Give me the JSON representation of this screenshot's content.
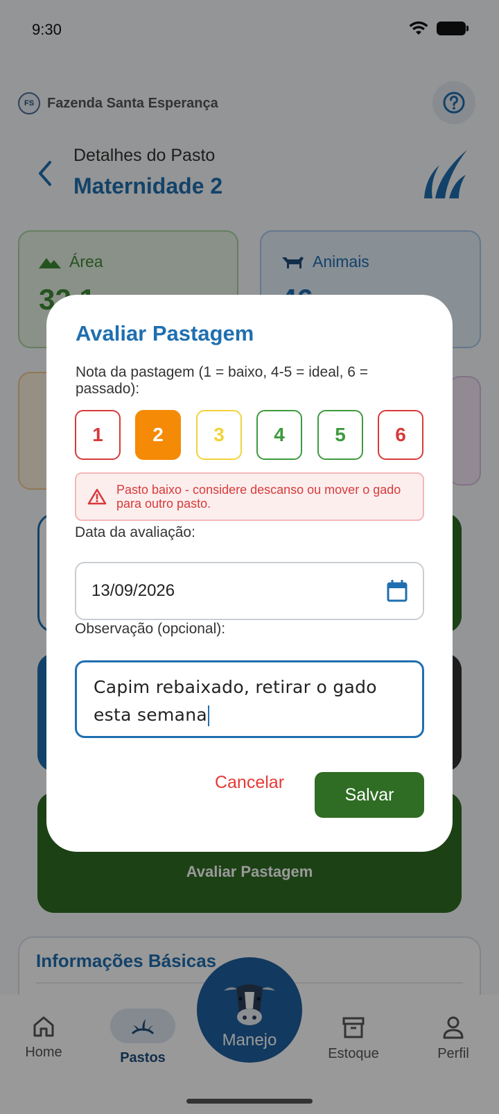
{
  "status": {
    "time": "9:30"
  },
  "farm": {
    "initials": "FS",
    "name": "Fazenda Santa Esperança"
  },
  "header": {
    "subtitle": "Detalhes do Pasto",
    "title": "Maternidade 2"
  },
  "stats": {
    "area": {
      "label": "Área",
      "value": "32,1"
    },
    "animais": {
      "label": "Animais",
      "value": "46"
    }
  },
  "actions": {
    "evaluate_label": "Avaliar Pastagem"
  },
  "info": {
    "title": "Informações Básicas"
  },
  "nav": {
    "home": "Home",
    "pastos": "Pastos",
    "manejo": "Manejo",
    "estoque": "Estoque",
    "perfil": "Perfil"
  },
  "dialog": {
    "title": "Avaliar Pastagem",
    "prompt": "Nota da pastagem (1 = baixo, 4-5 = ideal, 6 = passado):",
    "ratings": [
      {
        "label": "1",
        "color": "#d73a3a",
        "selected": false
      },
      {
        "label": "2",
        "color": "#f58a07",
        "selected": true
      },
      {
        "label": "3",
        "color": "#f2d23a",
        "selected": false
      },
      {
        "label": "4",
        "color": "#3d9a3d",
        "selected": false
      },
      {
        "label": "5",
        "color": "#3d9a3d",
        "selected": false
      },
      {
        "label": "6",
        "color": "#d73a3a",
        "selected": false
      }
    ],
    "warning": "Pasto baixo - considere descanso ou mover o gado para outro pasto.",
    "date_label": "Data da avaliação:",
    "date_value": "13/09/2026",
    "obs_label": "Observação (opcional):",
    "obs_value": "Capim rebaixado, retirar o gado esta semana",
    "cancel_label": "Cancelar",
    "save_label": "Salvar"
  },
  "colors": {
    "primary": "#1f6fb0",
    "success": "#2f6d24",
    "danger": "#e53935"
  }
}
